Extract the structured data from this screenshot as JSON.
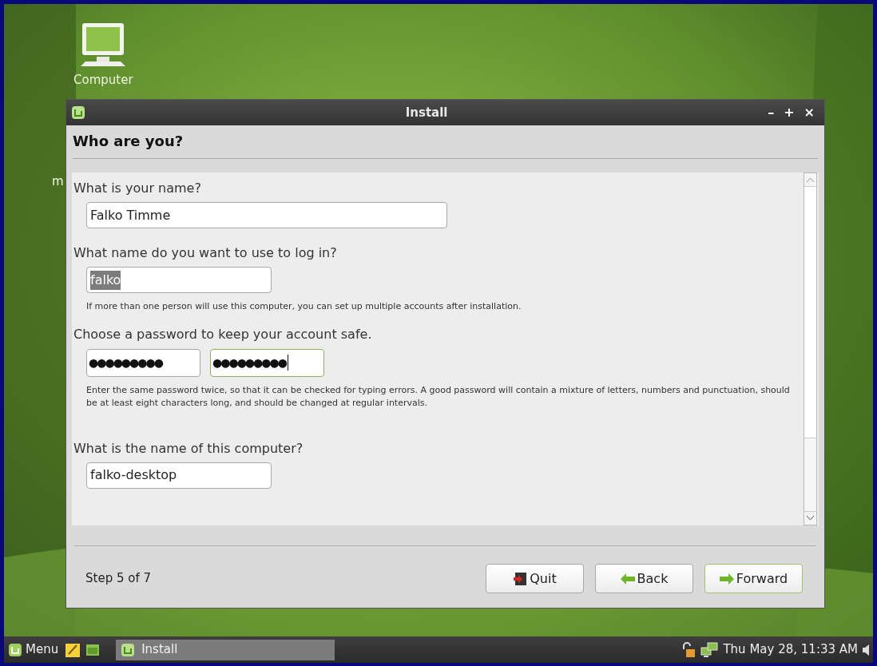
{
  "desktop": {
    "icons": [
      {
        "label": "Computer"
      }
    ],
    "partial_label": "m"
  },
  "window": {
    "title": "Install",
    "controls": [
      "–",
      "+",
      "×"
    ]
  },
  "page": {
    "heading": "Who are you?",
    "name": {
      "label": "What is your name?",
      "value": "Falko Timme"
    },
    "login": {
      "label": "What name do you want to use to log in?",
      "value": "falko",
      "selected": true,
      "hint": "If more than one person will use this computer, you can set up multiple accounts after installation."
    },
    "password": {
      "label": "Choose a password to keep your account safe.",
      "fields": [
        {
          "value": "●●●●●●●●●",
          "focused": false
        },
        {
          "value": "●●●●●●●●●",
          "focused": true
        }
      ],
      "hint": "Enter the same password twice, so that it can be checked for typing errors. A good password will contain a mixture of letters, numbers and punctuation, should be at least eight characters long, and should be changed at regular intervals."
    },
    "computer": {
      "label": "What is the name of this computer?",
      "value": "falko-desktop"
    }
  },
  "footer": {
    "step": "Step 5 of 7",
    "buttons": [
      {
        "kind": "quit",
        "label": "Quit",
        "focused": false
      },
      {
        "kind": "back",
        "label": "Back",
        "focused": false
      },
      {
        "kind": "forward",
        "label": "Forward",
        "focused": true
      }
    ]
  },
  "taskbar": {
    "menu": "Menu",
    "tasks": [
      {
        "label": "Install"
      }
    ],
    "clock": "Thu May 28, 11:33 AM"
  }
}
